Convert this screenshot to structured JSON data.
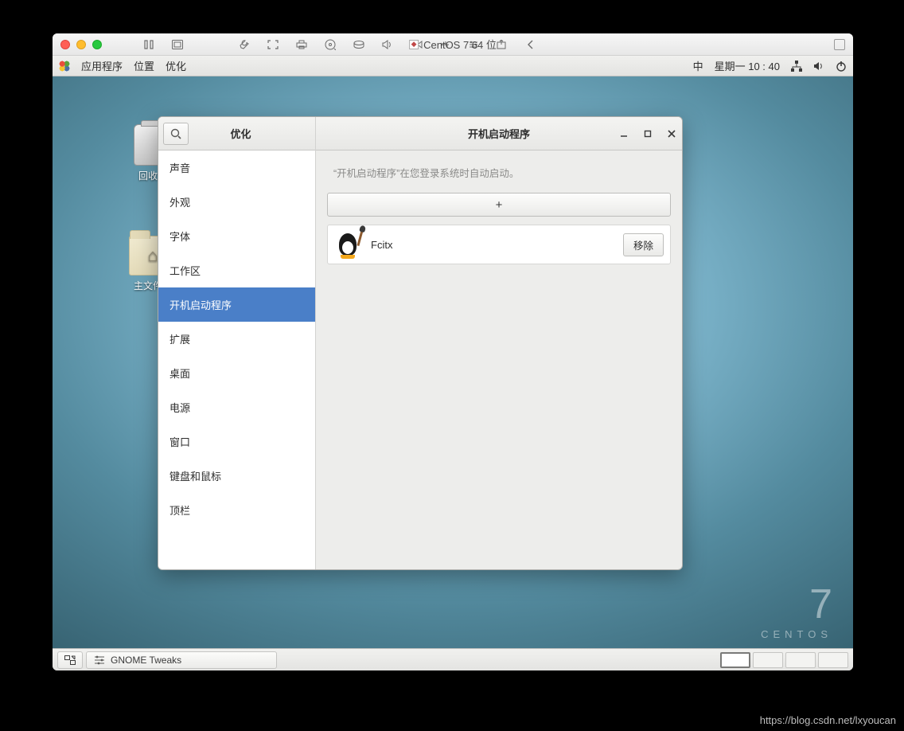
{
  "mac": {
    "title": "CentOS 7 64 位"
  },
  "gnome_top": {
    "apps": "应用程序",
    "places": "位置",
    "tweaks": "优化",
    "ime": "中",
    "clock": "星期一 10 : 40"
  },
  "desktop": {
    "trash": "回收站",
    "home": "主文件夹",
    "centos_text": "CENTOS",
    "seven": "7"
  },
  "tweaks": {
    "sidebar_title": "优化",
    "main_title": "开机启动程序",
    "hint": "“开机启动程序”在您登录系统时自动启动。",
    "add": "+",
    "items": [
      {
        "label": "声音"
      },
      {
        "label": "外观"
      },
      {
        "label": "字体"
      },
      {
        "label": "工作区"
      },
      {
        "label": "开机启动程序",
        "selected": true
      },
      {
        "label": "扩展"
      },
      {
        "label": "桌面"
      },
      {
        "label": "电源"
      },
      {
        "label": "窗口"
      },
      {
        "label": "键盘和鼠标"
      },
      {
        "label": "顶栏"
      }
    ],
    "startup": {
      "name": "Fcitx",
      "remove": "移除"
    }
  },
  "taskbar": {
    "app": "GNOME Tweaks"
  },
  "watermark": "https://blog.csdn.net/lxyoucan"
}
